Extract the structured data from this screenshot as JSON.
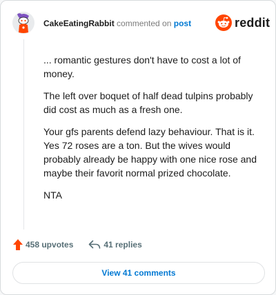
{
  "comment": {
    "username": "CakeEatingRabbit",
    "action_text": "commented on",
    "post_link": "post",
    "paragraphs": [
      "... romantic gestures don't have to cost a lot of money.",
      "The left over boquet of half dead tulpins probably did cost as much as a fresh one.",
      "Your gfs parents defend lazy behaviour. That is it. Yes 72 roses are a ton. But the wives would probably already be happy with one nice rose and maybe their favorit normal prized chocolate.",
      "NTA"
    ]
  },
  "brand": {
    "wordmark": "reddit",
    "icon": "reddit-snoo-icon",
    "color": "#ff4500"
  },
  "stats": {
    "upvotes": "458 upvotes",
    "upvote_icon": "upvote-arrow-icon",
    "replies": "41 replies",
    "reply_icon": "reply-arrow-icon"
  },
  "actions": {
    "view_comments": "View 41 comments"
  },
  "colors": {
    "accent": "#ff4500",
    "link": "#0079d3",
    "meta": "#576f76",
    "text": "#1c1c1c"
  }
}
